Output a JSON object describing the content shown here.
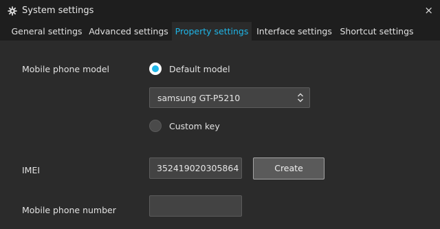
{
  "window": {
    "title": "System settings",
    "close_glyph": "×",
    "gear_icon": "gear-icon",
    "close_icon": "close-icon"
  },
  "tabs": [
    {
      "label": "General settings",
      "active": false
    },
    {
      "label": "Advanced settings",
      "active": false
    },
    {
      "label": "Property settings",
      "active": true
    },
    {
      "label": "Interface settings",
      "active": false
    },
    {
      "label": "Shortcut settings",
      "active": false
    }
  ],
  "colors": {
    "accent": "#1fb6e8",
    "background": "#2b2b2b",
    "titlebar": "#1e1e1e"
  },
  "model": {
    "label": "Mobile phone model",
    "default_option": "Default model",
    "default_selected": true,
    "selected_model": "samsung GT-P5210",
    "custom_option": "Custom key",
    "custom_selected": false
  },
  "imei": {
    "label": "IMEI",
    "value": "352419020305864",
    "create_button": "Create"
  },
  "phone": {
    "label": "Mobile phone number",
    "value": ""
  }
}
